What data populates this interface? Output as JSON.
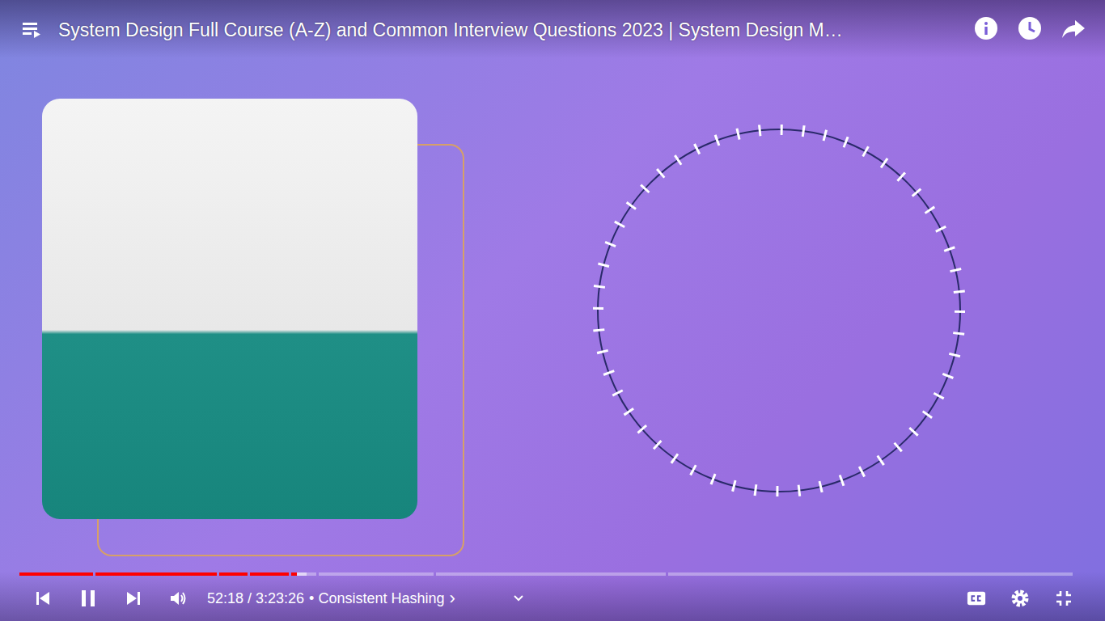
{
  "player": {
    "title": "System Design Full Course (A-Z) and Common Interview Questions 2023 | System Design M…",
    "time": "52:18 / 3:23:26",
    "chapter": "• Consistent Hashing",
    "chapter_arrow": "›",
    "playing": true,
    "muted": false
  },
  "progress": {
    "segments": [
      {
        "share": 0.07,
        "played": 1,
        "buffered": 1
      },
      {
        "share": 0.116,
        "played": 1,
        "buffered": 1
      },
      {
        "share": 0.027,
        "played": 1,
        "buffered": 1
      },
      {
        "share": 0.037,
        "played": 1,
        "buffered": 1
      },
      {
        "share": 0.024,
        "played": 0.22,
        "buffered": 0.59
      },
      {
        "share": 0.109,
        "played": 0,
        "buffered": 0
      },
      {
        "share": 0.219,
        "played": 0,
        "buffered": 0
      },
      {
        "share": 0.386,
        "played": 0,
        "buffered": 0
      }
    ]
  }
}
